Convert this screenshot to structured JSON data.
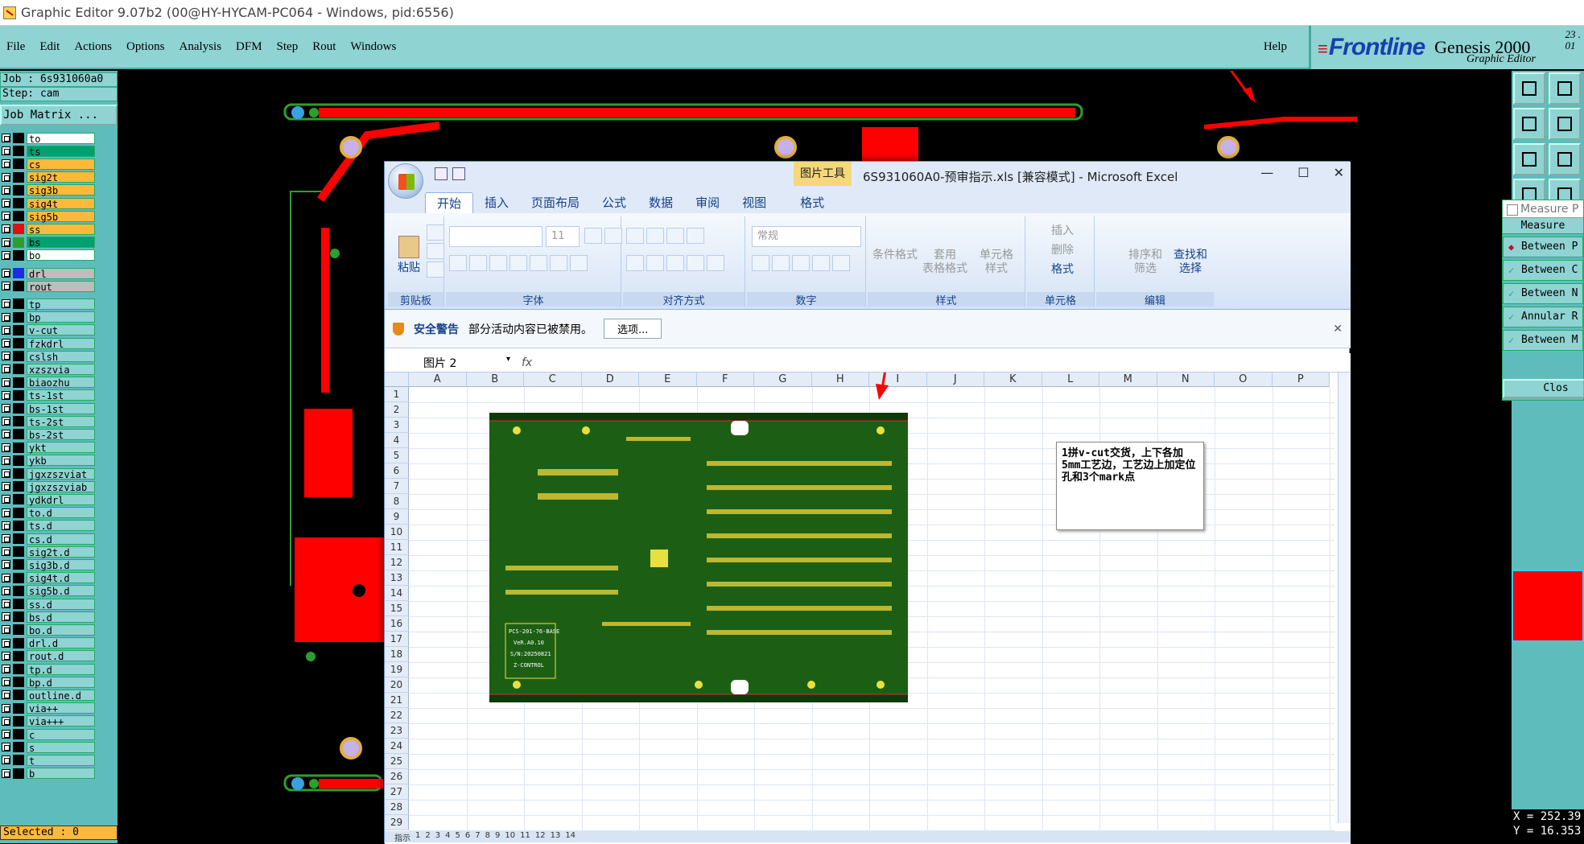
{
  "window": {
    "title": "Graphic Editor 9.07b2 (00@HY-HYCAM-PC064 - Windows, pid:6556)"
  },
  "menu": {
    "items": [
      "File",
      "Edit",
      "Actions",
      "Options",
      "Analysis",
      "DFM",
      "Step",
      "Rout",
      "Windows"
    ],
    "help": "Help"
  },
  "brand": {
    "logo": "Frontline",
    "product": "Genesis 2000",
    "sub": "Graphic Editor",
    "ver1": "23 .",
    "ver2": "01"
  },
  "left": {
    "job": "Job : 6s931060a0",
    "step": "Step: cam",
    "job_matrix": "Job Matrix ...",
    "selected": "Selected : 0",
    "layers": [
      {
        "name": "to",
        "bg": "#ffffff",
        "sw": "#000000"
      },
      {
        "name": "ts",
        "bg": "#00a070",
        "sw": "#000000"
      },
      {
        "name": "cs",
        "bg": "#ffb93a",
        "sw": "#000000"
      },
      {
        "name": "sig2t",
        "bg": "#ffb93a",
        "sw": "#000000"
      },
      {
        "name": "sig3b",
        "bg": "#ffb93a",
        "sw": "#000000"
      },
      {
        "name": "sig4t",
        "bg": "#ffb93a",
        "sw": "#000000"
      },
      {
        "name": "sig5b",
        "bg": "#ffb93a",
        "sw": "#000000"
      },
      {
        "name": "ss",
        "bg": "#ffb93a",
        "sw": "#e01010"
      },
      {
        "name": "bs",
        "bg": "#00a070",
        "sw": "#2e9e2e"
      },
      {
        "name": "bo",
        "bg": "#ffffff",
        "sw": "#000000"
      },
      {
        "name": "drl",
        "bg": "#bdbdbd",
        "sw": "#1a30e0",
        "gap": true
      },
      {
        "name": "rout",
        "bg": "#bdbdbd",
        "sw": "#000000"
      },
      {
        "name": "tp",
        "bg": "#8fd3d3",
        "sw": "#000000",
        "gap": true
      },
      {
        "name": "bp",
        "bg": "#8fd3d3",
        "sw": "#000000"
      },
      {
        "name": "v-cut",
        "bg": "#8fd3d3",
        "sw": "#000000"
      },
      {
        "name": "fzkdrl",
        "bg": "#8fd3d3",
        "sw": "#000000"
      },
      {
        "name": "cslsh",
        "bg": "#8fd3d3",
        "sw": "#000000"
      },
      {
        "name": "xzszvia",
        "bg": "#8fd3d3",
        "sw": "#000000"
      },
      {
        "name": "biaozhu",
        "bg": "#8fd3d3",
        "sw": "#000000"
      },
      {
        "name": "ts-1st",
        "bg": "#8fd3d3",
        "sw": "#000000"
      },
      {
        "name": "bs-1st",
        "bg": "#8fd3d3",
        "sw": "#000000"
      },
      {
        "name": "ts-2st",
        "bg": "#8fd3d3",
        "sw": "#000000"
      },
      {
        "name": "bs-2st",
        "bg": "#8fd3d3",
        "sw": "#000000"
      },
      {
        "name": "ykt",
        "bg": "#8fd3d3",
        "sw": "#000000"
      },
      {
        "name": "ykb",
        "bg": "#8fd3d3",
        "sw": "#000000"
      },
      {
        "name": "jgxzszviat",
        "bg": "#8fd3d3",
        "sw": "#000000"
      },
      {
        "name": "jgxzszviab",
        "bg": "#8fd3d3",
        "sw": "#000000"
      },
      {
        "name": "ydkdrl",
        "bg": "#8fd3d3",
        "sw": "#000000"
      },
      {
        "name": "to.d",
        "bg": "#8fd3d3",
        "sw": "#000000"
      },
      {
        "name": "ts.d",
        "bg": "#8fd3d3",
        "sw": "#000000"
      },
      {
        "name": "cs.d",
        "bg": "#8fd3d3",
        "sw": "#000000"
      },
      {
        "name": "sig2t.d",
        "bg": "#8fd3d3",
        "sw": "#000000"
      },
      {
        "name": "sig3b.d",
        "bg": "#8fd3d3",
        "sw": "#000000"
      },
      {
        "name": "sig4t.d",
        "bg": "#8fd3d3",
        "sw": "#000000"
      },
      {
        "name": "sig5b.d",
        "bg": "#8fd3d3",
        "sw": "#000000"
      },
      {
        "name": "ss.d",
        "bg": "#8fd3d3",
        "sw": "#000000"
      },
      {
        "name": "bs.d",
        "bg": "#8fd3d3",
        "sw": "#000000"
      },
      {
        "name": "bo.d",
        "bg": "#8fd3d3",
        "sw": "#000000"
      },
      {
        "name": "drl.d",
        "bg": "#8fd3d3",
        "sw": "#000000"
      },
      {
        "name": "rout.d",
        "bg": "#8fd3d3",
        "sw": "#000000"
      },
      {
        "name": "tp.d",
        "bg": "#8fd3d3",
        "sw": "#000000"
      },
      {
        "name": "bp.d",
        "bg": "#8fd3d3",
        "sw": "#000000"
      },
      {
        "name": "outline.d",
        "bg": "#8fd3d3",
        "sw": "#000000"
      },
      {
        "name": "via++",
        "bg": "#8fd3d3",
        "sw": "#000000"
      },
      {
        "name": "via+++",
        "bg": "#8fd3d3",
        "sw": "#000000"
      },
      {
        "name": "c",
        "bg": "#8fd3d3",
        "sw": "#000000"
      },
      {
        "name": "s",
        "bg": "#8fd3d3",
        "sw": "#000000"
      },
      {
        "name": "t",
        "bg": "#8fd3d3",
        "sw": "#000000"
      },
      {
        "name": "b",
        "bg": "#8fd3d3",
        "sw": "#000000"
      }
    ]
  },
  "measure": {
    "title": "Measure P",
    "header": "Measure",
    "options": [
      "Between P",
      "Between C",
      "Between N",
      "Annular R",
      "Between M"
    ],
    "close": "Clos"
  },
  "coords": {
    "x": "X = 252.39",
    "y": "Y = 16.353"
  },
  "excel": {
    "pic_tools": "图片工具",
    "title": "6S931060A0-预审指示.xls  [兼容模式] - Microsoft Excel",
    "tabs": [
      "开始",
      "插入",
      "页面布局",
      "公式",
      "数据",
      "审阅",
      "视图",
      "格式"
    ],
    "groups": {
      "clipboard": "剪贴板",
      "font": "字体",
      "align": "对齐方式",
      "number": "数字",
      "styles": "样式",
      "cells": "单元格",
      "editing": "编辑"
    },
    "btn": {
      "paste": "粘贴",
      "cond": "条件格式",
      "table1": "套用",
      "table2": "表格格式",
      "cellstyle1": "单元格",
      "cellstyle2": "样式",
      "insert": "插入",
      "delete": "删除",
      "format": "格式",
      "sort1": "排序和",
      "sort2": "筛选",
      "find1": "查找和",
      "find2": "选择",
      "font_size": "11",
      "num_format": "常规"
    },
    "warn": {
      "label": "安全警告",
      "text": "部分活动内容已被禁用。",
      "button": "选项..."
    },
    "namebox": "图片 2",
    "fx": "fx",
    "columns": [
      "A",
      "B",
      "C",
      "D",
      "E",
      "F",
      "G",
      "H",
      "I",
      "J",
      "K",
      "L",
      "M",
      "N",
      "O",
      "P"
    ],
    "rows": [
      "1",
      "2",
      "3",
      "4",
      "5",
      "6",
      "7",
      "8",
      "9",
      "10",
      "11",
      "12",
      "13",
      "14",
      "15",
      "16",
      "17",
      "18",
      "19",
      "20",
      "21",
      "22",
      "23",
      "24",
      "25",
      "26",
      "27",
      "28",
      "29"
    ],
    "note": "1拼v-cut交货，上下各加5mm工艺边，工艺边上加定位孔和3个mark点",
    "pcb_label": [
      "PCS-201-76-BASE",
      "VeR.A0.10",
      "S/N:20250821",
      "Z-CONTROL"
    ],
    "sheet_tabs": [
      "指示",
      "1",
      "2",
      "3",
      "4",
      "5",
      "6",
      "7",
      "8",
      "9",
      "10",
      "11",
      "12",
      "13",
      "14"
    ]
  }
}
